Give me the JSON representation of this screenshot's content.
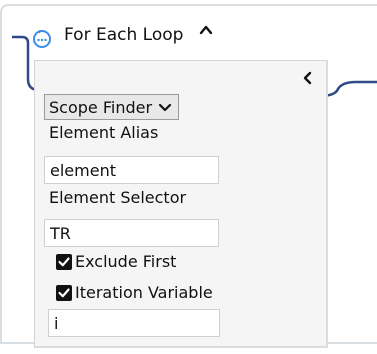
{
  "header": {
    "title": "For Each Loop",
    "icon": "loop-icon",
    "collapse_icon": "chevron-up-icon"
  },
  "panel": {
    "back_icon": "chevron-left-icon",
    "scope_button_label": "Scope Finder",
    "scope_button_icon": "chevron-down-icon",
    "fields": {
      "element_alias": {
        "label": "Element Alias",
        "value": "element"
      },
      "element_selector": {
        "label": "Element Selector",
        "value": "TR"
      },
      "iteration_variable_value": "i"
    },
    "checkboxes": {
      "exclude_first": {
        "label": "Exclude First",
        "checked": true
      },
      "iteration_variable": {
        "label": "Iteration Variable",
        "checked": true
      }
    }
  },
  "colors": {
    "connector": "#2f4a86",
    "icon_blue": "#3a8ee6",
    "card_border": "#d9dee3",
    "panel_bg": "#f5f5f5"
  }
}
